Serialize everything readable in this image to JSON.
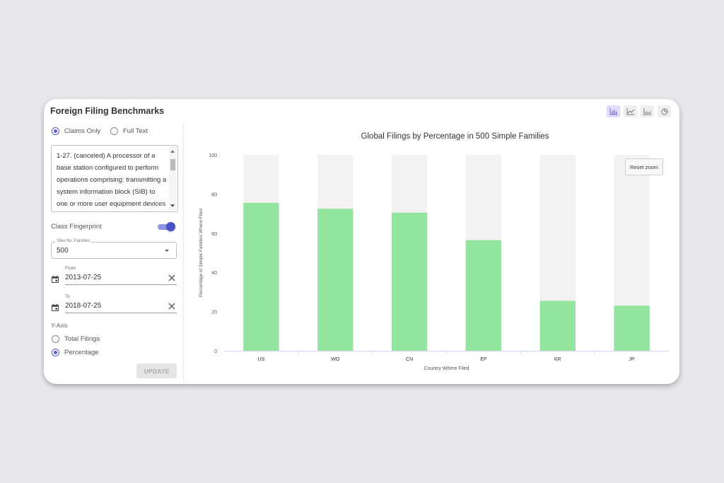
{
  "panel": {
    "title": "Foreign Filing Benchmarks",
    "search_mode": {
      "options": [
        {
          "label": "Claims Only",
          "selected": true
        },
        {
          "label": "Full Text",
          "selected": false
        }
      ]
    },
    "query_text": "1-27. (canceled) A processor of a base station configured to perform operations comprising: transmitting a system information block (SIB) to one or more user equipment devices",
    "class_fingerprint": {
      "label": "Class Fingerprint",
      "enabled": true
    },
    "max_families": {
      "label": "Max No. Families",
      "value": "500"
    },
    "from": {
      "label": "From",
      "value": "2013-07-25"
    },
    "to": {
      "label": "To",
      "value": "2018-07-25"
    },
    "y_axis": {
      "label": "Y-Axis",
      "options": [
        {
          "label": "Total Filings",
          "selected": false
        },
        {
          "label": "Percentage",
          "selected": true
        }
      ]
    },
    "update_label": "UPDATE"
  },
  "view_icons": [
    "bar-chart-icon",
    "line-chart-icon",
    "area-chart-icon",
    "pie-chart-icon"
  ],
  "reset_zoom_label": "Reset zoom",
  "colors": {
    "accent": "#5a5fcf",
    "bar": "#93e49c",
    "bar_track": "#f2f2f2"
  },
  "chart_data": {
    "type": "bar",
    "title": "Global Filings by Percentage in 500 Simple Families",
    "xlabel": "Country Where Filed",
    "ylabel": "Percentage of Simple Families Where Filed",
    "categories": [
      "US",
      "WO",
      "CN",
      "EP",
      "KR",
      "JP"
    ],
    "values": [
      75.5,
      72.5,
      70.5,
      56.5,
      25.5,
      23
    ],
    "ylim": [
      0,
      100
    ],
    "yticks": [
      0,
      20,
      40,
      60,
      80,
      100
    ],
    "grid": false,
    "legend": "none"
  }
}
